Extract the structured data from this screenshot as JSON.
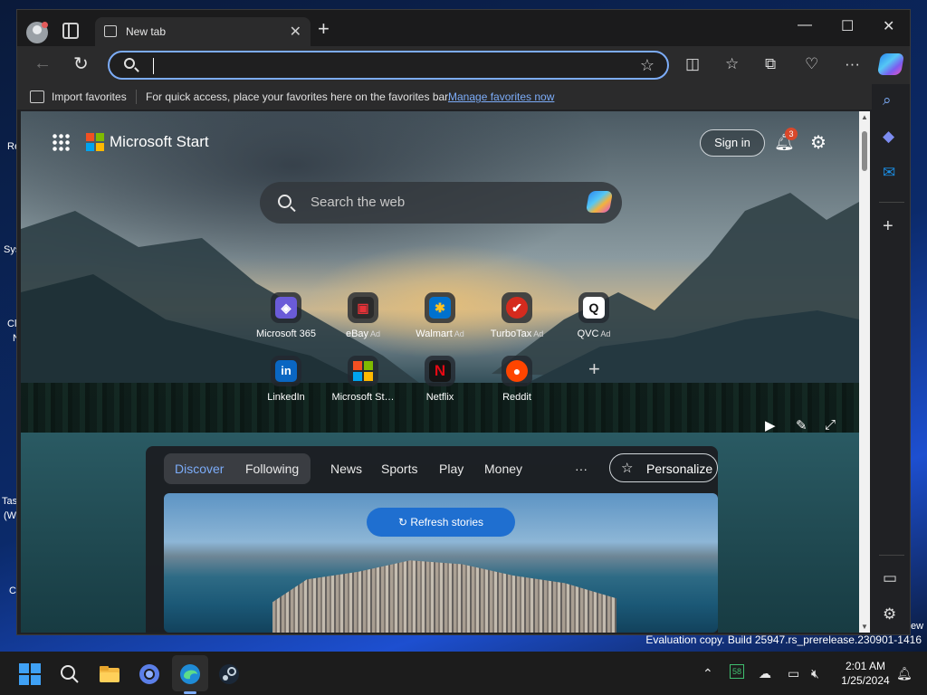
{
  "desktop": {
    "fragments": [
      "Re",
      "Sys",
      "Cl",
      "N",
      "Tas",
      "(W",
      "C",
      "ew"
    ],
    "evaluation_text": "Evaluation copy. Build 25947.rs_prerelease.230901-1416"
  },
  "browser": {
    "tab": {
      "title": "New tab",
      "close_glyph": "✕"
    },
    "new_tab_glyph": "+",
    "window_controls": {
      "minimize": "—",
      "maximize": "☐",
      "close": "✕"
    },
    "address_bar": {
      "value": "",
      "placeholder": ""
    },
    "favorites_bar": {
      "import_label": "Import favorites",
      "hint": "For quick access, place your favorites here on the favorites bar.",
      "manage_link": "Manage favorites now"
    },
    "toolbar_icons": [
      "split-screen-icon",
      "favorites-icon",
      "collections-icon",
      "browser-essentials-icon",
      "more-icon",
      "copilot-icon"
    ],
    "sidebar_icons": [
      "search-icon",
      "copilot-icon",
      "outlook-icon",
      "add-icon",
      "layout-icon",
      "settings-icon"
    ]
  },
  "newtab": {
    "brand": "Microsoft Start",
    "sign_in": "Sign in",
    "notification_count": "3",
    "search_placeholder": "Search the web",
    "quick_links": [
      {
        "name": "Microsoft 365",
        "ad": "",
        "glyph": "◈",
        "color": "#6a5bd8"
      },
      {
        "name": "eBay",
        "ad": "Ad",
        "glyph": "▣",
        "color": "#e53238"
      },
      {
        "name": "Walmart",
        "ad": "Ad",
        "glyph": "✱",
        "color": "#0071ce"
      },
      {
        "name": "TurboTax",
        "ad": "Ad",
        "glyph": "✔",
        "color": "#d52b1e"
      },
      {
        "name": "QVC",
        "ad": "Ad",
        "glyph": "Q",
        "color": "#ffffff"
      },
      {
        "name": "LinkedIn",
        "ad": "",
        "glyph": "in",
        "color": "#0a66c2"
      },
      {
        "name": "Microsoft St…",
        "ad": "",
        "glyph": "",
        "color": "#f25022"
      },
      {
        "name": "Netflix",
        "ad": "",
        "glyph": "N",
        "color": "#e50914"
      },
      {
        "name": "Reddit",
        "ad": "",
        "glyph": "●",
        "color": "#ff4500"
      }
    ],
    "feed": {
      "tabs": [
        "Discover",
        "Following"
      ],
      "nav": [
        "News",
        "Sports",
        "Play",
        "Money"
      ],
      "more": "···",
      "personalize": "Personalize",
      "refresh": "Refresh stories"
    }
  },
  "taskbar": {
    "apps": [
      "start-icon",
      "search-icon",
      "file-explorer-icon",
      "chrome-icon",
      "edge-icon",
      "steam-icon"
    ],
    "tray_badge": "58",
    "time": "2:01 AM",
    "date": "1/25/2024"
  }
}
